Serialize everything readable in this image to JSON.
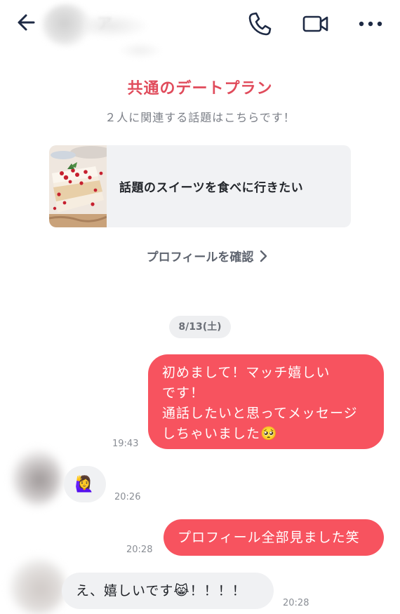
{
  "header": {
    "back_icon": "back-arrow-icon",
    "name_visible_fragment": "ア",
    "phone_icon": "phone-icon",
    "video_icon": "video-camera-icon",
    "more_icon": "more-horizontal-icon"
  },
  "date_plan": {
    "title": "共通のデートプラン",
    "subtitle": "２人に関連する話題はこちらです！",
    "card_text": "話題のスイーツを食べに行きたい",
    "thumb_icon": "sweets-cake-image",
    "profile_link": "プロフィールを確認"
  },
  "chat": {
    "date_label": "8/13(土)",
    "messages": [
      {
        "direction": "outgoing",
        "lines": [
          "初めまして！マッチ嬉しい",
          "です！",
          "通話したいと思ってメッセージ",
          "しちゃいました🥺"
        ],
        "time": "19:43"
      },
      {
        "direction": "incoming",
        "sticker": "🙋‍♀️",
        "time": "20:26"
      },
      {
        "direction": "outgoing",
        "text": "プロフィール全部見ました笑",
        "time": "20:28"
      },
      {
        "direction": "incoming",
        "text": "え、嬉しいです😹！！！！",
        "time": "20:28"
      }
    ]
  },
  "colors": {
    "accent": "#e04b5b",
    "outgoing_bubble": "#f7535f",
    "incoming_bubble": "#f0f1f3",
    "card_bg": "#f1f2f4",
    "icon_color": "#1e2a44"
  }
}
